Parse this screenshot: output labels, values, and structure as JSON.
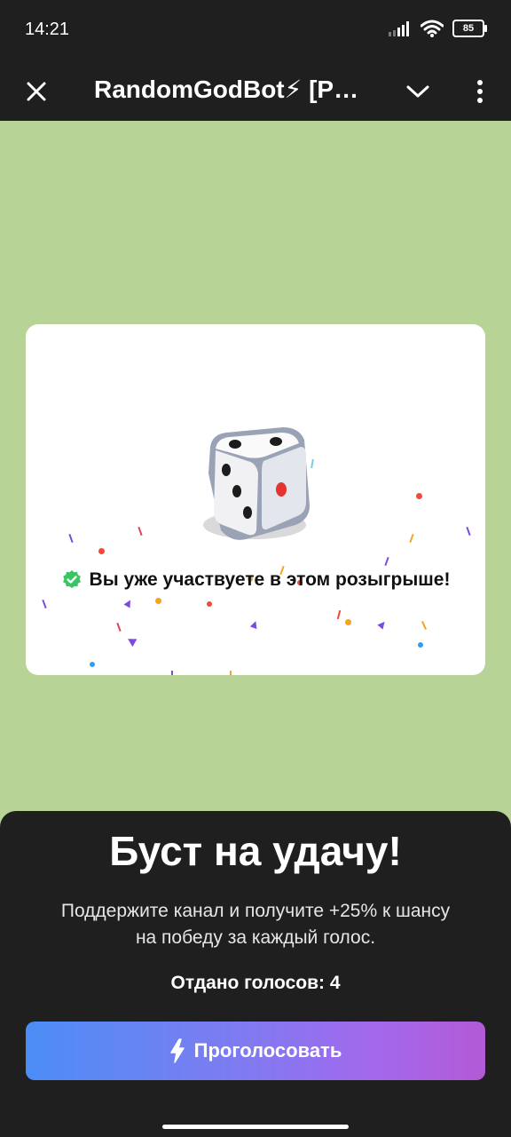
{
  "status_bar": {
    "time": "14:21",
    "battery": "85",
    "icons": [
      "signal-icon",
      "wifi-icon",
      "battery-icon"
    ]
  },
  "header": {
    "title": "RandomGodBot⚡ [P…",
    "icons": [
      "close-icon",
      "chevron-down-icon",
      "more-vertical-icon"
    ]
  },
  "card": {
    "icon": "dice-icon",
    "status_icon": "check-badge-icon",
    "message": "Вы уже участвуете в этом розыгрыше!"
  },
  "boost": {
    "title": "Буст на удачу!",
    "description": "Поддержите канал и получите +25% к шансу на победу за каждый голос.",
    "votes_text": "Отдано голосов: 4",
    "button_label": "Проголосовать",
    "button_icon": "lightning-icon"
  },
  "colors": {
    "background": "#b7d496",
    "bar": "#1f1f1f",
    "success": "#3bc463",
    "button_gradient": [
      "#4c8df5",
      "#b35ad6"
    ]
  }
}
